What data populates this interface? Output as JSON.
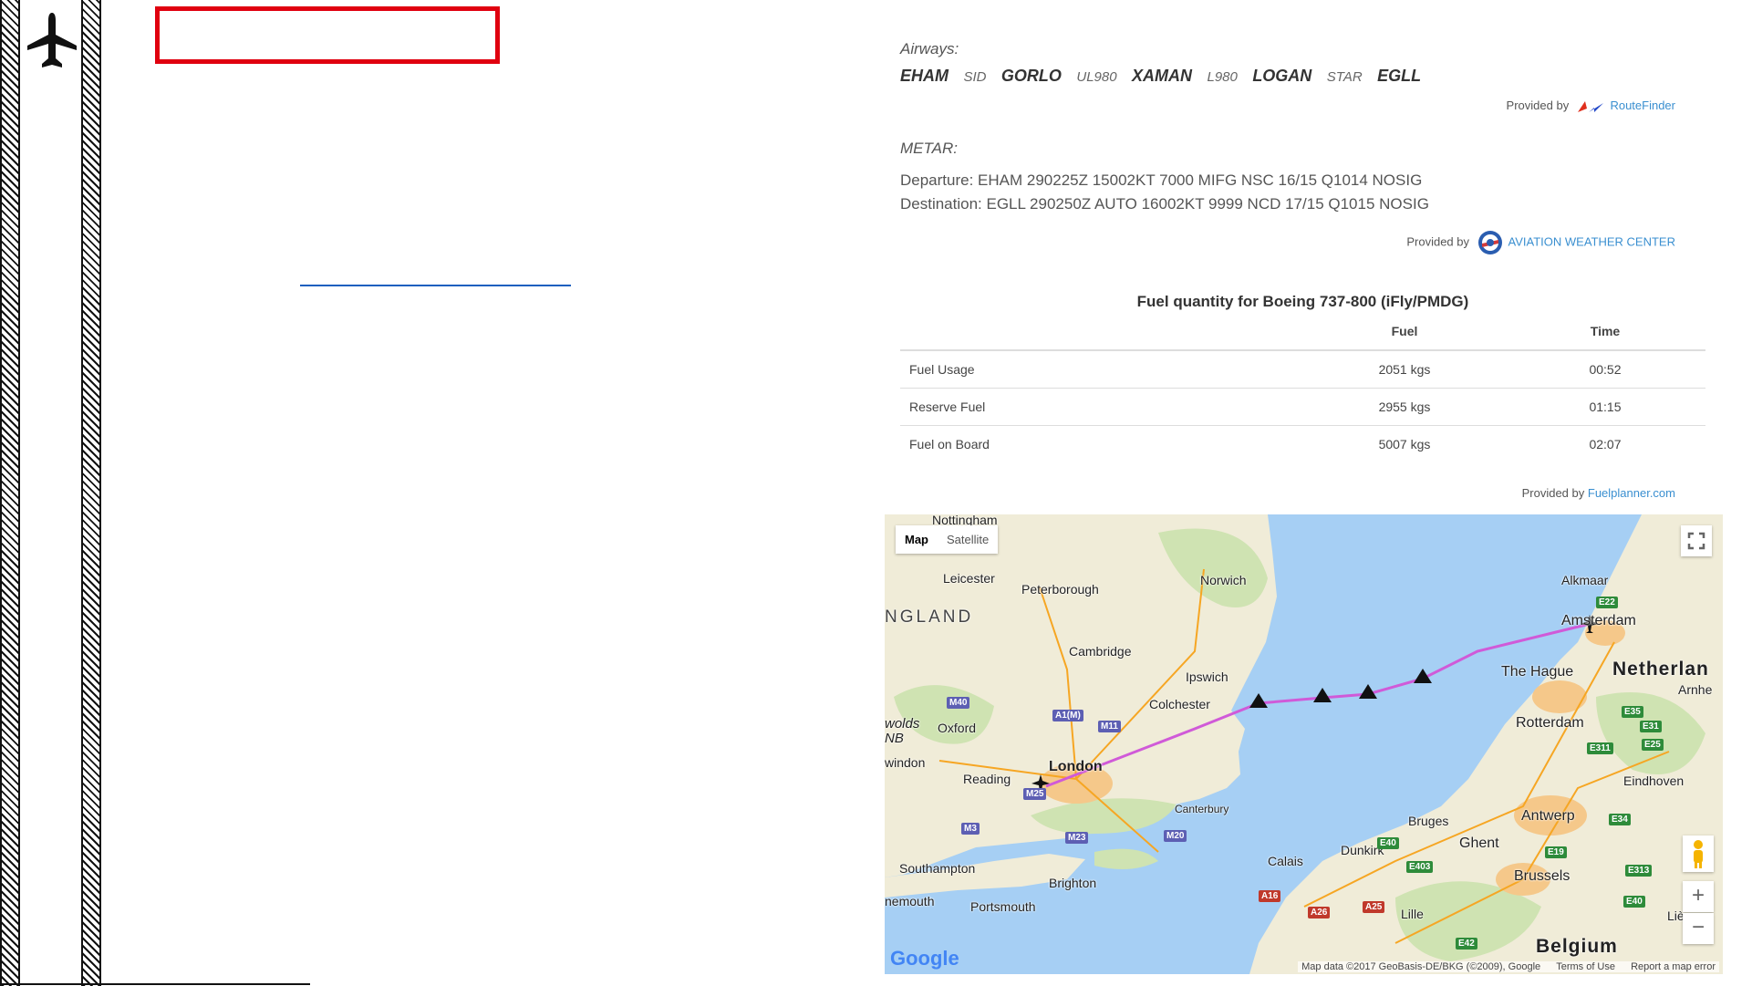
{
  "airways": {
    "label": "Airways:",
    "route": [
      {
        "kind": "wp",
        "text": "EHAM"
      },
      {
        "kind": "aw",
        "text": "SID"
      },
      {
        "kind": "wp",
        "text": "GORLO"
      },
      {
        "kind": "aw",
        "text": "UL980"
      },
      {
        "kind": "wp",
        "text": "XAMAN"
      },
      {
        "kind": "aw",
        "text": "L980"
      },
      {
        "kind": "wp",
        "text": "LOGAN"
      },
      {
        "kind": "aw",
        "text": "STAR"
      },
      {
        "kind": "wp",
        "text": "EGLL"
      }
    ],
    "provided_prefix": "Provided by",
    "provider": "RouteFinder"
  },
  "metar": {
    "label": "METAR:",
    "departure": "Departure: EHAM 290225Z 15002KT 7000 MIFG NSC 16/15 Q1014 NOSIG",
    "destination": "Destination: EGLL 290250Z AUTO 16002KT 9999 NCD 17/15 Q1015 NOSIG",
    "provided_prefix": "Provided by",
    "provider": "AVIATION WEATHER CENTER"
  },
  "fuel": {
    "title": "Fuel quantity for Boeing 737-800 (iFly/PMDG)",
    "headers": [
      "",
      "Fuel",
      "Time"
    ],
    "rows": [
      [
        "Fuel Usage",
        "2051 kgs",
        "00:52"
      ],
      [
        "Reserve Fuel",
        "2955 kgs",
        "01:15"
      ],
      [
        "Fuel on Board",
        "5007 kgs",
        "02:07"
      ]
    ],
    "provided_prefix": "Provided by",
    "provider": "Fuelplanner.com"
  },
  "map": {
    "toggle_map": "Map",
    "toggle_satellite": "Satellite",
    "zoom_in": "+",
    "zoom_out": "−",
    "logo": "Google",
    "attribution": "Map data ©2017 GeoBasis-DE/BKG (©2009), Google",
    "terms": "Terms of Use",
    "report": "Report a map error",
    "places": [
      "Nottingham",
      "Leicester",
      "Peterborough",
      "Norwich",
      "NGLAND",
      "Cambridge",
      "Ipswich",
      "Colchester",
      "Oxford",
      "Reading",
      "London",
      "Canterbury",
      "wolds NB",
      "windon",
      "Southampton",
      "Brighton",
      "nemouth",
      "Portsmouth",
      "Alkmaar",
      "Amsterdam",
      "The Hague",
      "Netherlan",
      "Rotterdam",
      "Eindhoven",
      "Arnhe",
      "Antwerp",
      "Bruges",
      "Ghent",
      "Brussels",
      "Calais",
      "Dunkirk",
      "Lille",
      "Liè",
      "Belgium"
    ],
    "roads": [
      "M40",
      "A1(M)",
      "M11",
      "M3",
      "M23",
      "M20",
      "M25",
      "E22",
      "E35",
      "E31",
      "E25",
      "E311",
      "E34",
      "E19",
      "E40",
      "E403",
      "E313",
      "A16",
      "A26",
      "A25",
      "E42",
      "E40"
    ],
    "route_color": "#d05ad8"
  }
}
